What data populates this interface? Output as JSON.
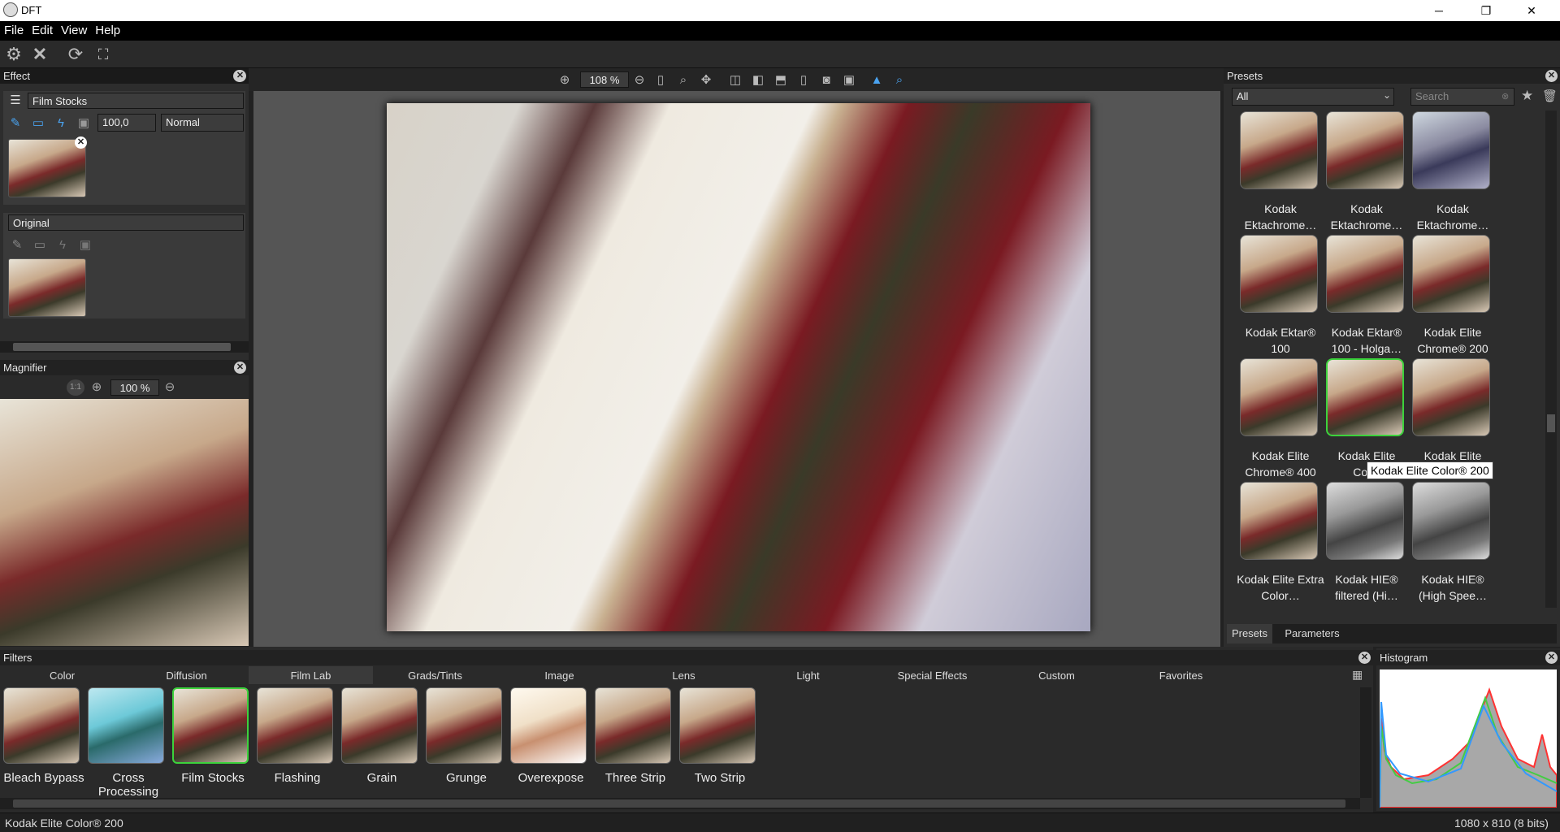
{
  "window": {
    "title": "DFT",
    "minimize": "─",
    "restore": "❐",
    "close": "✕"
  },
  "menu": [
    {
      "label": "File"
    },
    {
      "label": "Edit"
    },
    {
      "label": "View"
    },
    {
      "label": "Help"
    }
  ],
  "effect_panel": {
    "title": "Effect",
    "layer_name": "Film Stocks",
    "opacity": "100,0",
    "blend_mode": "Normal",
    "original_label": "Original"
  },
  "viewer": {
    "zoom": "108 %"
  },
  "magnifier": {
    "title": "Magnifier",
    "ratio_label": "1:1",
    "zoom": "100 %"
  },
  "presets": {
    "title": "Presets",
    "filter": "All",
    "search_placeholder": "Search",
    "items": [
      {
        "label": "Kodak Ektachrome…"
      },
      {
        "label": "Kodak Ektachrome…"
      },
      {
        "label": "Kodak Ektachrome…"
      },
      {
        "label": "Kodak Ektar® 100"
      },
      {
        "label": "Kodak Ektar® 100 - Holga…"
      },
      {
        "label": "Kodak Elite Chrome® 200"
      },
      {
        "label": "Kodak Elite Chrome® 400"
      },
      {
        "label": "Kodak Elite Color"
      },
      {
        "label": "Kodak Elite"
      },
      {
        "label": "Kodak Elite Extra Color…"
      },
      {
        "label": "Kodak HIE® filtered (Hi…"
      },
      {
        "label": "Kodak HIE® (High Spee…"
      }
    ],
    "tooltip": "Kodak Elite Color® 200",
    "tabs": [
      {
        "label": "Presets"
      },
      {
        "label": "Parameters"
      }
    ]
  },
  "filters": {
    "title": "Filters",
    "tabs": [
      {
        "label": "Color"
      },
      {
        "label": "Diffusion"
      },
      {
        "label": "Film Lab"
      },
      {
        "label": "Grads/Tints"
      },
      {
        "label": "Image"
      },
      {
        "label": "Lens"
      },
      {
        "label": "Light"
      },
      {
        "label": "Special Effects"
      },
      {
        "label": "Custom"
      },
      {
        "label": "Favorites"
      }
    ],
    "items": [
      {
        "label": "Bleach Bypass"
      },
      {
        "label": "Cross Processing"
      },
      {
        "label": "Film Stocks"
      },
      {
        "label": "Flashing"
      },
      {
        "label": "Grain"
      },
      {
        "label": "Grunge"
      },
      {
        "label": "Overexpose"
      },
      {
        "label": "Three Strip"
      },
      {
        "label": "Two Strip"
      }
    ]
  },
  "histogram": {
    "title": "Histogram"
  },
  "status": {
    "left": "Kodak Elite Color® 200",
    "right": "1080 x 810 (8 bits)"
  },
  "colors": {
    "accent_selected": "#3cd23c",
    "bg": "#222222"
  }
}
